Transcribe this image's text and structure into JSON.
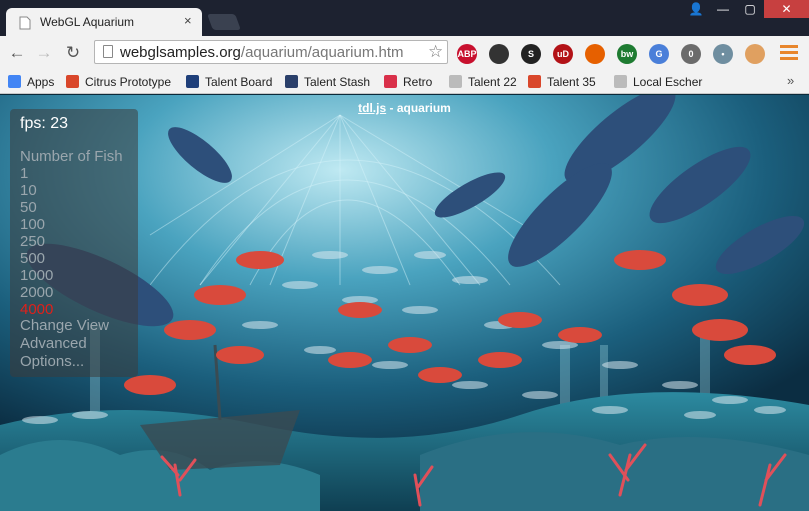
{
  "browser": {
    "tab_title": "WebGL Aquarium",
    "tab_close": "×",
    "url_host": "webglsamples.org",
    "url_path": "/aquarium/aquarium.htm",
    "window_buttons": {
      "user": "👤",
      "minimize": "—",
      "maximize": "▢",
      "close": "✕"
    }
  },
  "extensions": [
    {
      "name": "adblock-plus-icon",
      "label": "ABP",
      "color": "#c8102e"
    },
    {
      "name": "tv-extension-icon",
      "label": "",
      "color": "#333333"
    },
    {
      "name": "s-extension-icon",
      "label": "S",
      "color": "#222222"
    },
    {
      "name": "ublock-icon",
      "label": "uD",
      "color": "#b31217"
    },
    {
      "name": "firefox-like-icon",
      "label": "",
      "color": "#e66000"
    },
    {
      "name": "bw-extension-icon",
      "label": "bw",
      "color": "#1e7b31"
    },
    {
      "name": "google-translate-icon",
      "label": "G",
      "color": "#4a7fd9"
    },
    {
      "name": "ghostery-icon",
      "label": "0",
      "color": "#6b6b6b"
    },
    {
      "name": "dots-extension-icon",
      "label": "•",
      "color": "#6f8ea0"
    },
    {
      "name": "orange-extension-icon",
      "label": "",
      "color": "#e0a060"
    }
  ],
  "bookmarks": [
    {
      "label": "Apps",
      "icon": "apps-grid-icon",
      "color": "#4285f4"
    },
    {
      "label": "Citrus Prototype",
      "icon": "citrus-icon",
      "color": "#d9472b"
    },
    {
      "label": "Talent Board",
      "icon": "talent-board-icon",
      "color": "#1f3f7a"
    },
    {
      "label": "Talent Stash",
      "icon": "talent-stash-icon",
      "color": "#2a3f6a"
    },
    {
      "label": "Retro",
      "icon": "retro-icon",
      "color": "#d9304a"
    },
    {
      "label": "Talent 22",
      "icon": "page-icon",
      "color": "#bbbbbb"
    },
    {
      "label": "Talent 35",
      "icon": "citrus-icon",
      "color": "#d9472b"
    },
    {
      "label": "Local Escher",
      "icon": "page-icon",
      "color": "#bbbbbb"
    }
  ],
  "page": {
    "header_link": "tdl.js",
    "header_text": " - aquarium"
  },
  "controls": {
    "fps_label": "fps: 23",
    "number_of_fish_label": "Number of Fish",
    "fish_counts": [
      "1",
      "10",
      "50",
      "100",
      "250",
      "500",
      "1000",
      "2000",
      "4000"
    ],
    "selected_count": "4000",
    "selected_color": "#e0201a",
    "change_view": "Change View",
    "advanced": "Advanced",
    "options": "Options..."
  }
}
